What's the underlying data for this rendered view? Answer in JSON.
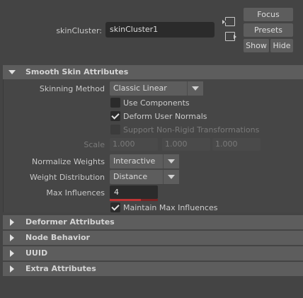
{
  "header": {
    "node_label": "skinCluster:",
    "node_value": "skinCluster1",
    "focus": "Focus",
    "presets": "Presets",
    "show": "Show",
    "hide": "Hide"
  },
  "sections": {
    "smooth_skin": "Smooth Skin Attributes",
    "deformer": "Deformer Attributes",
    "node_behavior": "Node Behavior",
    "uuid": "UUID",
    "extra": "Extra Attributes"
  },
  "smooth_skin": {
    "skinning_method_label": "Skinning Method",
    "skinning_method_value": "Classic Linear",
    "use_components": {
      "label": "Use Components",
      "checked": false
    },
    "deform_user_normals": {
      "label": "Deform User Normals",
      "checked": true
    },
    "support_non_rigid": {
      "label": "Support Non-Rigid Transformations",
      "checked": false,
      "disabled": true
    },
    "scale_label": "Scale",
    "scale_values": [
      "1.000",
      "1.000",
      "1.000"
    ],
    "normalize_weights_label": "Normalize Weights",
    "normalize_weights_value": "Interactive",
    "weight_distribution_label": "Weight Distribution",
    "weight_distribution_value": "Distance",
    "max_influences_label": "Max Influences",
    "max_influences_value": "4",
    "maintain_max_influences": {
      "label": "Maintain Max Influences",
      "checked": true
    }
  },
  "colors": {
    "background": "#444444",
    "section_header": "#5d5d5d",
    "field": "#2b2b2b",
    "slider_accent": "#c03434"
  }
}
